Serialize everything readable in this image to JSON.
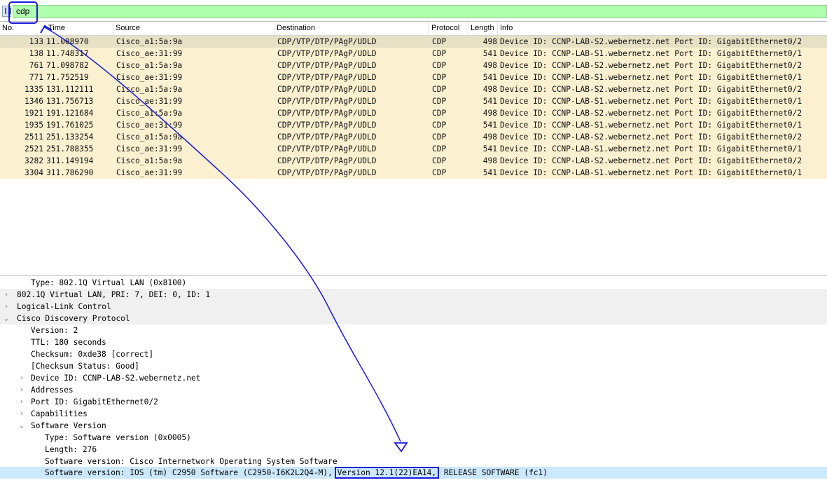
{
  "filter": {
    "value": "cdp"
  },
  "columns": [
    "No.",
    "Time",
    "Source",
    "Destination",
    "Protocol",
    "Length",
    "Info"
  ],
  "packets": [
    {
      "no": "133",
      "time": "11.088970",
      "src": "Cisco_a1:5a:9a",
      "dst": "CDP/VTP/DTP/PAgP/UDLD",
      "proto": "CDP",
      "len": "498",
      "info": "Device ID: CCNP-LAB-S2.webernetz.net  Port ID: GigabitEthernet0/2"
    },
    {
      "no": "138",
      "time": "11.748317",
      "src": "Cisco_ae:31:99",
      "dst": "CDP/VTP/DTP/PAgP/UDLD",
      "proto": "CDP",
      "len": "541",
      "info": "Device ID: CCNP-LAB-S1.webernetz.net  Port ID: GigabitEthernet0/1"
    },
    {
      "no": "761",
      "time": "71.098782",
      "src": "Cisco_a1:5a:9a",
      "dst": "CDP/VTP/DTP/PAgP/UDLD",
      "proto": "CDP",
      "len": "498",
      "info": "Device ID: CCNP-LAB-S2.webernetz.net  Port ID: GigabitEthernet0/2"
    },
    {
      "no": "771",
      "time": "71.752519",
      "src": "Cisco_ae:31:99",
      "dst": "CDP/VTP/DTP/PAgP/UDLD",
      "proto": "CDP",
      "len": "541",
      "info": "Device ID: CCNP-LAB-S1.webernetz.net  Port ID: GigabitEthernet0/1"
    },
    {
      "no": "1335",
      "time": "131.112111",
      "src": "Cisco_a1:5a:9a",
      "dst": "CDP/VTP/DTP/PAgP/UDLD",
      "proto": "CDP",
      "len": "498",
      "info": "Device ID: CCNP-LAB-S2.webernetz.net  Port ID: GigabitEthernet0/2"
    },
    {
      "no": "1346",
      "time": "131.756713",
      "src": "Cisco_ae:31:99",
      "dst": "CDP/VTP/DTP/PAgP/UDLD",
      "proto": "CDP",
      "len": "541",
      "info": "Device ID: CCNP-LAB-S1.webernetz.net  Port ID: GigabitEthernet0/1"
    },
    {
      "no": "1921",
      "time": "191.121684",
      "src": "Cisco_a1:5a:9a",
      "dst": "CDP/VTP/DTP/PAgP/UDLD",
      "proto": "CDP",
      "len": "498",
      "info": "Device ID: CCNP-LAB-S2.webernetz.net  Port ID: GigabitEthernet0/2"
    },
    {
      "no": "1935",
      "time": "191.761025",
      "src": "Cisco_ae:31:99",
      "dst": "CDP/VTP/DTP/PAgP/UDLD",
      "proto": "CDP",
      "len": "541",
      "info": "Device ID: CCNP-LAB-S1.webernetz.net  Port ID: GigabitEthernet0/1"
    },
    {
      "no": "2511",
      "time": "251.133254",
      "src": "Cisco_a1:5a:9a",
      "dst": "CDP/VTP/DTP/PAgP/UDLD",
      "proto": "CDP",
      "len": "498",
      "info": "Device ID: CCNP-LAB-S2.webernetz.net  Port ID: GigabitEthernet0/2"
    },
    {
      "no": "2521",
      "time": "251.788355",
      "src": "Cisco_ae:31:99",
      "dst": "CDP/VTP/DTP/PAgP/UDLD",
      "proto": "CDP",
      "len": "541",
      "info": "Device ID: CCNP-LAB-S1.webernetz.net  Port ID: GigabitEthernet0/1"
    },
    {
      "no": "3282",
      "time": "311.149194",
      "src": "Cisco_a1:5a:9a",
      "dst": "CDP/VTP/DTP/PAgP/UDLD",
      "proto": "CDP",
      "len": "498",
      "info": "Device ID: CCNP-LAB-S2.webernetz.net  Port ID: GigabitEthernet0/2"
    },
    {
      "no": "3304",
      "time": "311.786290",
      "src": "Cisco_ae:31:99",
      "dst": "CDP/VTP/DTP/PAgP/UDLD",
      "proto": "CDP",
      "len": "541",
      "info": "Device ID: CCNP-LAB-S1.webernetz.net  Port ID: GigabitEthernet0/1"
    }
  ],
  "scroll": {
    "left_arrow": "<"
  },
  "details": [
    {
      "indent": 2,
      "arrow": "",
      "text": "Type: 802.1Q Virtual LAN (0x8100)"
    },
    {
      "indent": 1,
      "arrow": "›",
      "text": "802.1Q Virtual LAN, PRI: 7, DEI: 0, ID: 1"
    },
    {
      "indent": 1,
      "arrow": "›",
      "text": "Logical-Link Control"
    },
    {
      "indent": 1,
      "arrow": "⌄",
      "text": "Cisco Discovery Protocol"
    },
    {
      "indent": 2,
      "arrow": "",
      "text": "Version: 2"
    },
    {
      "indent": 2,
      "arrow": "",
      "text": "TTL: 180 seconds"
    },
    {
      "indent": 2,
      "arrow": "",
      "text": "Checksum: 0xde38 [correct]"
    },
    {
      "indent": 2,
      "arrow": "",
      "text": "[Checksum Status: Good]"
    },
    {
      "indent": 2,
      "arrow": "›",
      "text": "Device ID: CCNP-LAB-S2.webernetz.net"
    },
    {
      "indent": 2,
      "arrow": "›",
      "text": "Addresses"
    },
    {
      "indent": 2,
      "arrow": "›",
      "text": "Port ID: GigabitEthernet0/2"
    },
    {
      "indent": 2,
      "arrow": "›",
      "text": "Capabilities"
    },
    {
      "indent": 2,
      "arrow": "⌄",
      "text": "Software Version"
    },
    {
      "indent": 3,
      "arrow": "",
      "text": "Type: Software version (0x0005)"
    },
    {
      "indent": 3,
      "arrow": "",
      "text": "Length: 276"
    },
    {
      "indent": 3,
      "arrow": "",
      "text": "Software version: Cisco Internetwork Operating System Software"
    }
  ],
  "last_detail": {
    "prefix": "Software version: IOS (tm) C2950 Software (C2950-I6K2L2Q4-M),",
    "highlight": "Version 12.1(22)EA14,",
    "suffix": "RELEASE SOFTWARE (fc1)"
  },
  "colors": {
    "filter_bg": "#afffaf",
    "row_bg": "#fbf0cf",
    "annotation": "#1a1adc",
    "selected_detail": "#cce8ff"
  }
}
